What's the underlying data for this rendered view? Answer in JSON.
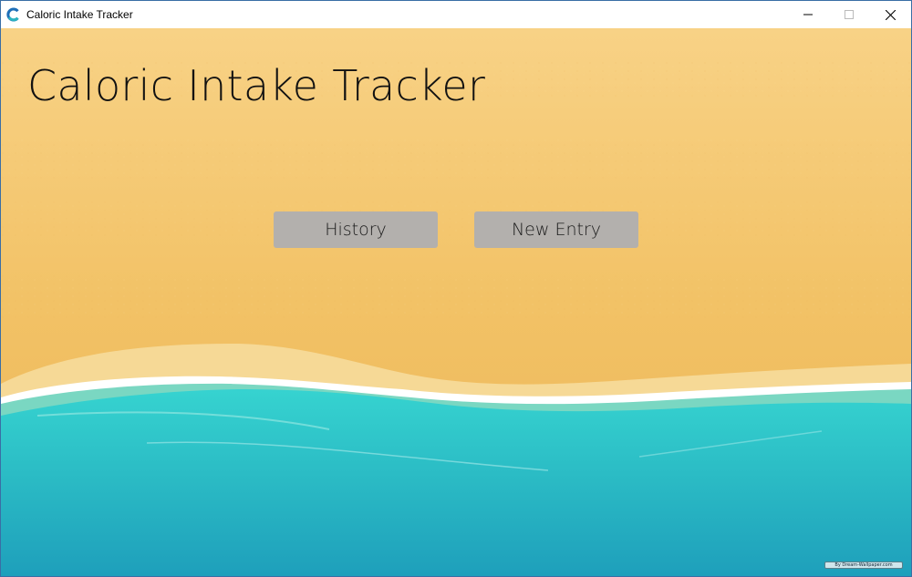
{
  "window": {
    "title": "Caloric Intake Tracker",
    "icon": "app-c-logo-icon",
    "controls": [
      "minimize-icon",
      "maximize-icon",
      "close-icon"
    ]
  },
  "main": {
    "title": "Caloric Intake Tracker",
    "buttons": {
      "history": "History",
      "new_entry": "New Entry"
    }
  },
  "background": {
    "scene": "beach",
    "credit": "By Dream-Wallpaper.com"
  },
  "colors": {
    "sand": "#f3c56f",
    "water": "#29bcc4",
    "button": "#b3b0ad"
  }
}
